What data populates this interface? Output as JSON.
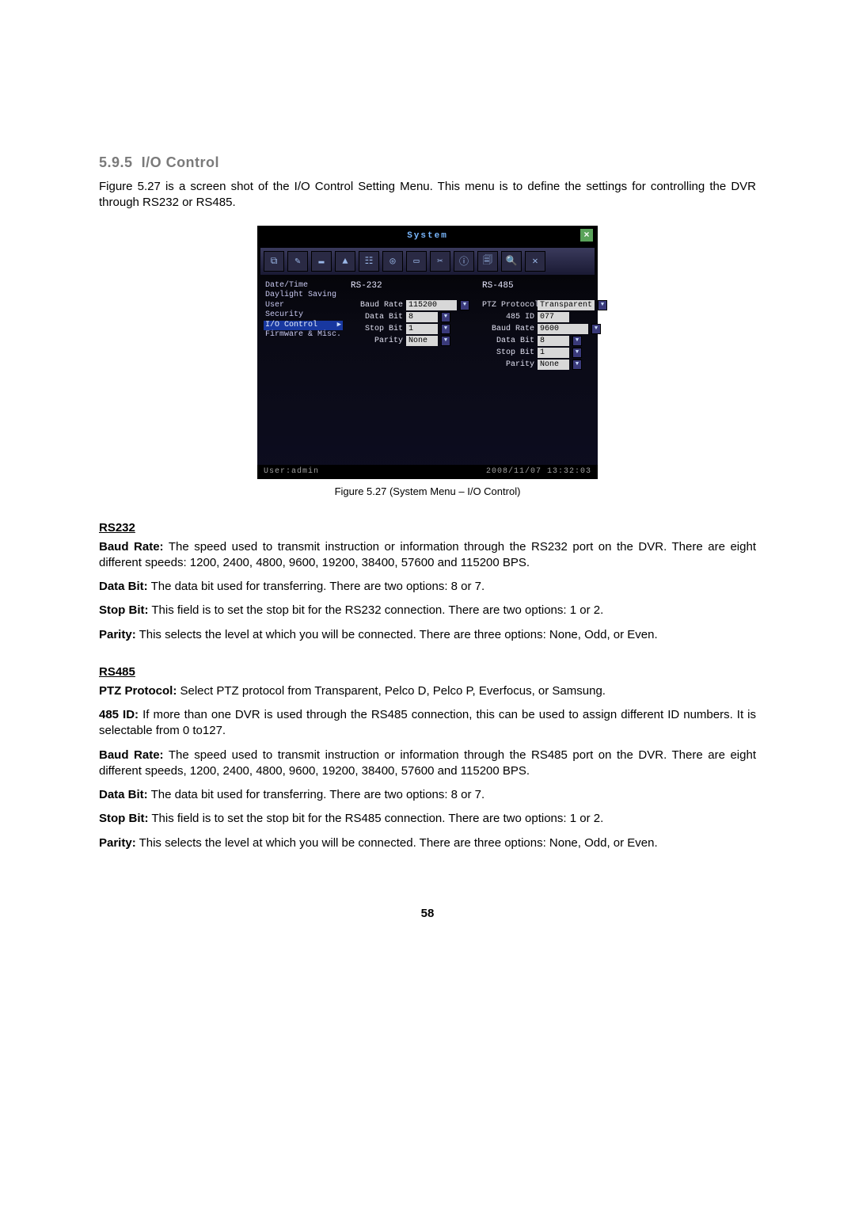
{
  "doc": {
    "heading_num": "5.9.5",
    "heading_title": "I/O Control",
    "intro": "Figure 5.27 is a screen shot of the I/O Control Setting Menu. This menu is to define the settings for controlling the DVR through RS232 or RS485.",
    "caption": "Figure 5.27 (System Menu – I/O Control)",
    "rs232_head": "RS232",
    "rs232": {
      "baud": {
        "b": "Baud Rate:",
        "t": " The speed used to transmit instruction or information through the RS232 port on the DVR. There are eight different speeds: 1200, 2400, 4800, 9600, 19200, 38400, 57600 and 115200 BPS."
      },
      "data": {
        "b": "Data Bit:",
        "t": " The data bit used for transferring. There are two options: 8 or 7."
      },
      "stop": {
        "b": "Stop Bit:",
        "t": " This field is to set the stop bit for the RS232 connection. There are two options: 1 or 2."
      },
      "parity": {
        "b": "Parity:",
        "t": " This selects the level at which you will be connected. There are three options: None, Odd, or Even."
      }
    },
    "rs485_head": "RS485",
    "rs485": {
      "ptz": {
        "b": "PTZ Protocol:",
        "t": " Select PTZ protocol from Transparent, Pelco D, Pelco P, Everfocus, or Samsung."
      },
      "id": {
        "b": "485 ID:",
        "t": " If more than one DVR is used through the RS485 connection, this can be used to assign different ID numbers. It is selectable from 0 to127."
      },
      "baud": {
        "b": "Baud Rate:",
        "t": " The speed used to transmit instruction or information through the RS485 port on the DVR. There are eight different speeds, 1200, 2400, 4800, 9600, 19200, 38400, 57600 and 115200 BPS."
      },
      "data": {
        "b": "Data Bit:",
        "t": " The data bit used for transferring. There are two options: 8 or 7."
      },
      "stop": {
        "b": "Stop Bit:",
        "t": " This field is to set the stop bit for the RS485 connection. There are two options: 1 or 2."
      },
      "parity": {
        "b": "Parity:",
        "t": " This selects the level at which you will be connected. There are three options: None, Odd, or Even."
      }
    },
    "page_number": "58"
  },
  "shot": {
    "window_title": "System",
    "close_label": "×",
    "toolbar_icons": [
      "⧉",
      "✎",
      "▬",
      "▲",
      "☷",
      "◎",
      "▭",
      "✂",
      "ⓘ",
      "🗐",
      "🔍",
      "✕"
    ],
    "sidebar": {
      "items": [
        "Date/Time",
        "Daylight Saving",
        "User",
        "Security",
        "I/O Control",
        "Firmware & Misc."
      ],
      "selected_index": 4
    },
    "rs232": {
      "title": "RS-232",
      "rows": [
        {
          "label": "Baud Rate",
          "value": "115200",
          "wide": true,
          "dropdown": true
        },
        {
          "label": "Data Bit",
          "value": "8",
          "dropdown": true
        },
        {
          "label": "Stop Bit",
          "value": "1",
          "dropdown": true
        },
        {
          "label": "Parity",
          "value": "None",
          "dropdown": true
        }
      ]
    },
    "rs485": {
      "title": "RS-485",
      "rows": [
        {
          "label": "PTZ Protocol",
          "value": "Transparent",
          "wide": true,
          "dropdown": true
        },
        {
          "label": "485 ID",
          "value": "077",
          "dropdown": false
        },
        {
          "label": "Baud Rate",
          "value": "9600",
          "wide": true,
          "dropdown": true
        },
        {
          "label": "Data Bit",
          "value": "8",
          "dropdown": true
        },
        {
          "label": "Stop Bit",
          "value": "1",
          "dropdown": true
        },
        {
          "label": "Parity",
          "value": "None",
          "dropdown": true
        }
      ]
    },
    "status": {
      "user_label": "User:admin",
      "timestamp": "2008/11/07  13:32:03"
    }
  }
}
